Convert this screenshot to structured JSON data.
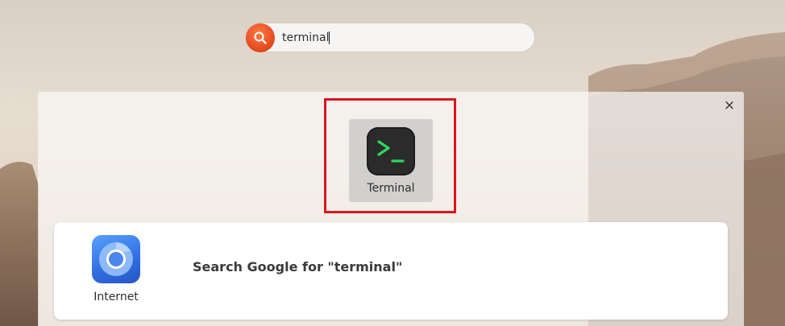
{
  "search": {
    "query": "terminal",
    "icon": "search-icon"
  },
  "results": {
    "close_icon": "×",
    "apps": [
      {
        "label": "Terminal",
        "icon": "terminal-icon"
      }
    ],
    "provider": {
      "name": "Internet",
      "icon": "chrome-icon",
      "result_text": "Search Google for \"terminal\""
    }
  },
  "colors": {
    "search_accent": "#e8501f",
    "highlight": "#d8161f",
    "terminal_prompt": "#2bd95a"
  }
}
